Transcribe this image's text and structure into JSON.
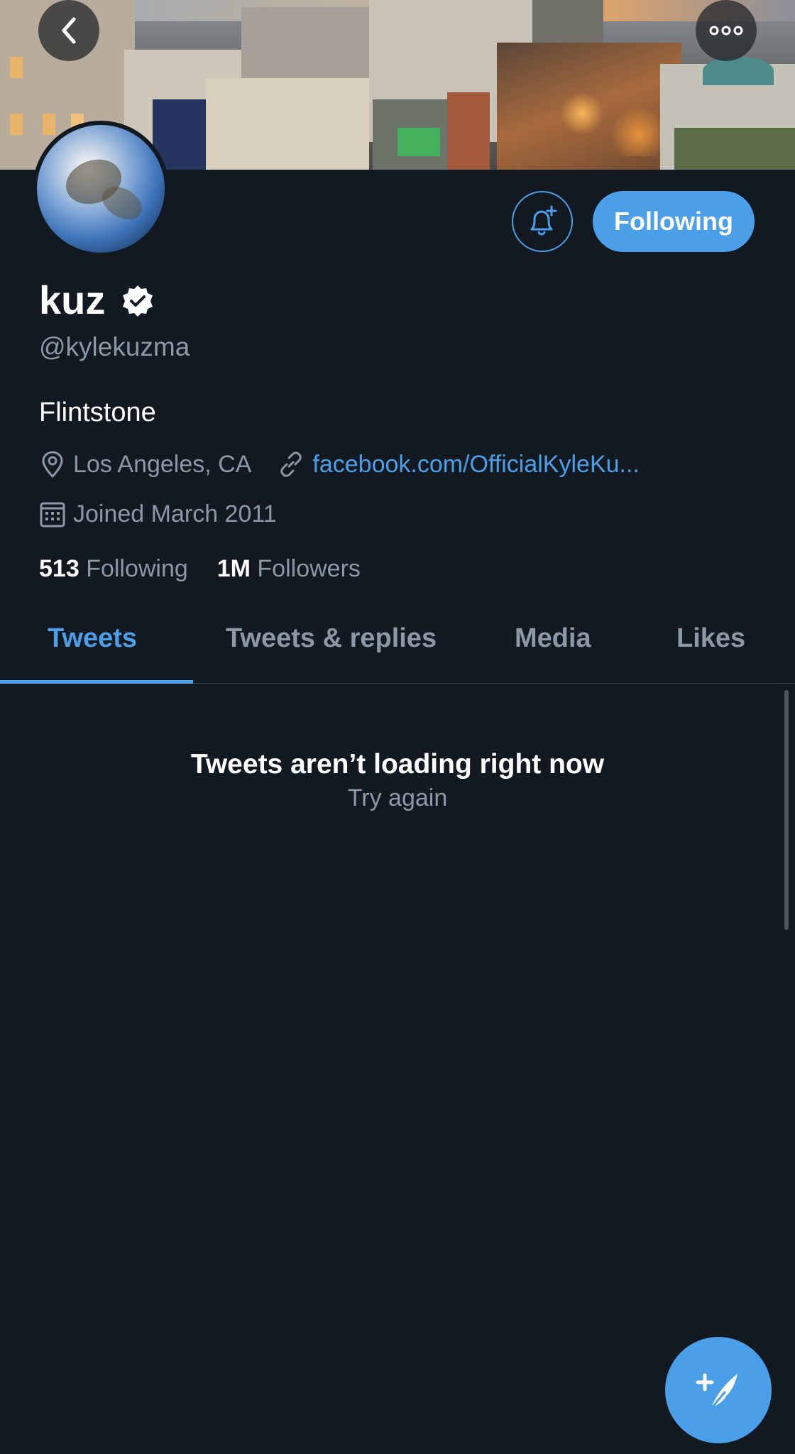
{
  "header": {
    "back_icon": "chevron-left-icon",
    "more_icon": "more-dots-icon"
  },
  "profile": {
    "display_name": "kuz",
    "verified_icon": "verified-badge-icon",
    "handle": "@kylekuzma",
    "bio": "Flintstone",
    "location": "Los Angeles, CA",
    "website": "facebook.com/OfficialKyleKu...",
    "joined": "Joined March 2011",
    "following_count": "513",
    "following_label": "Following",
    "followers_count": "1M",
    "followers_label": "Followers"
  },
  "actions": {
    "notify_icon": "bell-plus-icon",
    "follow_label": "Following"
  },
  "tabs": [
    {
      "label": "Tweets",
      "active": true
    },
    {
      "label": "Tweets & replies",
      "active": false
    },
    {
      "label": "Media",
      "active": false
    },
    {
      "label": "Likes",
      "active": false
    }
  ],
  "feed": {
    "error_title": "Tweets aren’t loading right now",
    "retry_label": "Try again"
  },
  "compose": {
    "icon": "compose-tweet-icon"
  },
  "colors": {
    "background": "#131921",
    "accent": "#4b9fe9",
    "secondary_text": "#8b98a5"
  }
}
